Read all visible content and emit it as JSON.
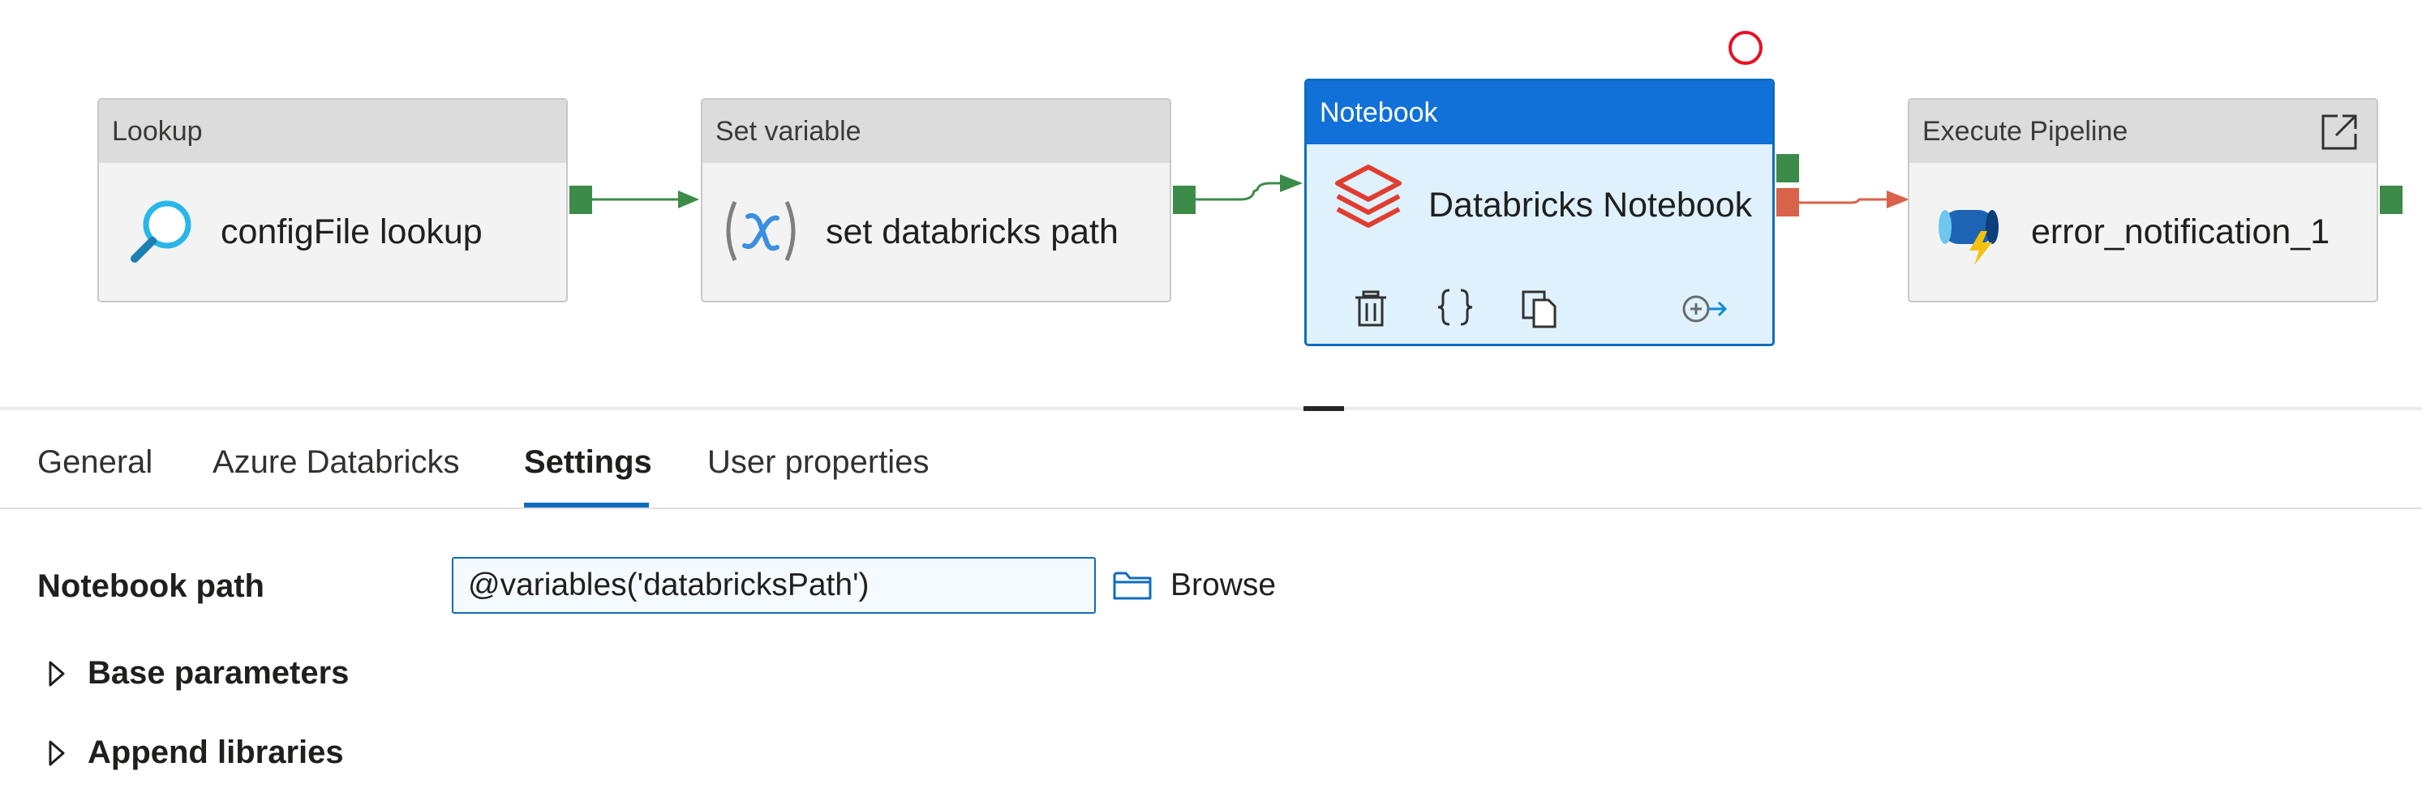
{
  "pipeline": {
    "activities": [
      {
        "type": "Lookup",
        "name": "configFile lookup",
        "icon": "magnifier-icon"
      },
      {
        "type": "Set variable",
        "name": "set databricks path",
        "icon": "variable-x-icon"
      },
      {
        "type": "Notebook",
        "name": "Databricks Notebook",
        "icon": "databricks-icon",
        "selected": true
      },
      {
        "type": "Execute Pipeline",
        "name": "error_notification_1",
        "icon": "execute-pipeline-icon"
      }
    ],
    "colors": {
      "success": "#3d8b48",
      "failure": "#d9624a",
      "selected": "#1171d8",
      "error": "#e81123"
    }
  },
  "tabs": [
    {
      "label": "General"
    },
    {
      "label": "Azure Databricks"
    },
    {
      "label": "Settings",
      "active": true
    },
    {
      "label": "User properties"
    }
  ],
  "settings": {
    "notebook_path_label": "Notebook path",
    "notebook_path_value": "@variables('databricksPath')",
    "browse_label": "Browse",
    "base_parameters_label": "Base parameters",
    "append_libraries_label": "Append libraries"
  }
}
